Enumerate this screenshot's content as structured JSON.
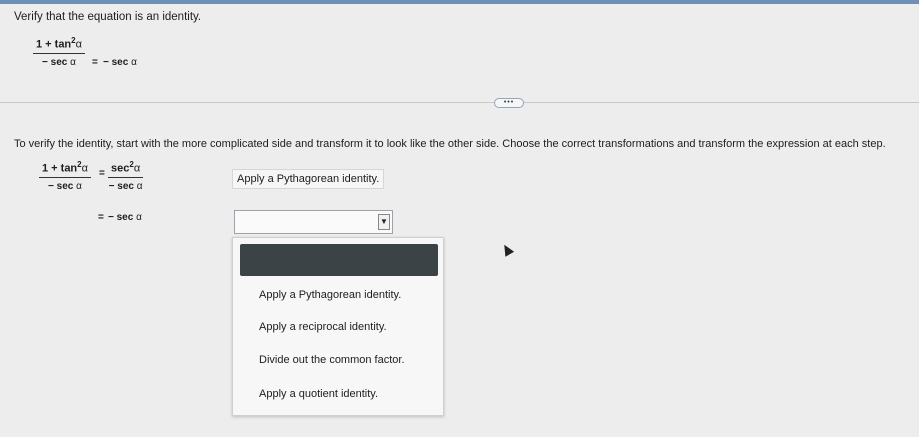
{
  "question": {
    "title": "Verify that the equation is an identity.",
    "equation": {
      "numerator_prefix": "1 + tan",
      "exponent": "2",
      "angle": "α",
      "denominator_prefix": "− sec ",
      "equals": "=",
      "rhs_prefix": "− sec "
    }
  },
  "more_button": {
    "label": "•••"
  },
  "instruction": "To verify the identity, start with the more complicated side and transform it to look like the other side. Choose the correct transformations and transform the expression at each step.",
  "step1": {
    "lhs_num_prefix": "1 + tan",
    "exponent": "2",
    "angle": "α",
    "lhs_den_prefix": "− sec ",
    "equals": "=",
    "rhs_num_prefix": "sec",
    "rhs_den_prefix": "− sec ",
    "transformation": "Apply a Pythagorean identity."
  },
  "step2": {
    "equals": "=",
    "expr_prefix": "− sec ",
    "angle": "α",
    "select_arrow": "▼"
  },
  "dropdown": {
    "options": [
      "Apply a Pythagorean identity.",
      "Apply a reciprocal identity.",
      "Divide out the common factor.",
      "Apply a quotient identity."
    ]
  }
}
